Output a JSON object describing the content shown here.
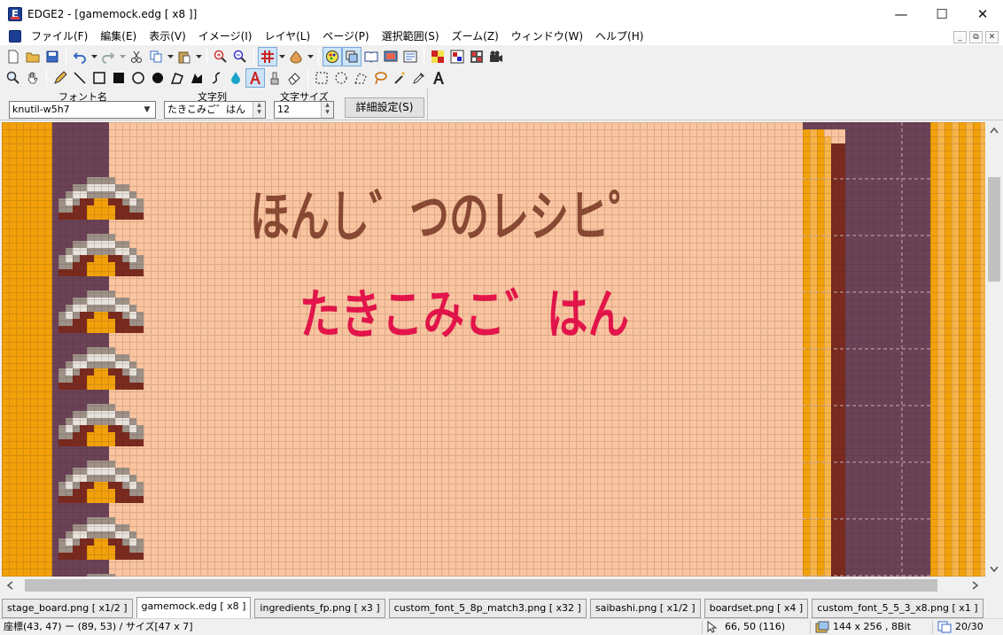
{
  "window": {
    "title": "EDGE2 - [gamemock.edg [ x8 ]]",
    "minimize": "—",
    "maximize": "☐",
    "close": "✕"
  },
  "menu": {
    "items": [
      "ファイル(F)",
      "編集(E)",
      "表示(V)",
      "イメージ(I)",
      "レイヤ(L)",
      "ページ(P)",
      "選択範囲(S)",
      "ズーム(Z)",
      "ウィンドウ(W)",
      "ヘルプ(H)"
    ],
    "mdi_minimize": "_",
    "mdi_restore": "⧉",
    "mdi_close": "✕"
  },
  "fontbar": {
    "font_label": "フォント名",
    "font_value": "knutil-w5h7",
    "text_label": "文字列",
    "text_value": "たきこみご゛はん",
    "size_label": "文字サイズ",
    "size_value": "12",
    "detail_button": "詳細設定(S)"
  },
  "canvas": {
    "heading_text": "ほんし゛つのレシヒ゜",
    "heading_color": "#8a4a34",
    "body_text": "たきこみこ゛はん",
    "body_color": "#e8144c",
    "background_color": "#f9c49f",
    "left_strip_color": "#f2a10a",
    "panel_color": "#6b4256"
  },
  "tabs": [
    {
      "label": "stage_board.png [ x1/2 ]",
      "active": false
    },
    {
      "label": "gamemock.edg [ x8 ]",
      "active": true
    },
    {
      "label": "ingredients_fp.png [ x3 ]",
      "active": false
    },
    {
      "label": "custom_font_5_8p_match3.png [ x32 ]",
      "active": false
    },
    {
      "label": "saibashi.png [ x1/2 ]",
      "active": false
    },
    {
      "label": "boardset.png [ x4 ]",
      "active": false
    },
    {
      "label": "custom_font_5_5_3_x8.png [ x1 ]",
      "active": false
    }
  ],
  "status": {
    "selection": "座標(43, 47) ー (89, 53) / サイズ[47 x 7]",
    "cursor": "66, 50 (116)",
    "image_info": "144 x 256 , 8Bit",
    "page": "20/30"
  }
}
